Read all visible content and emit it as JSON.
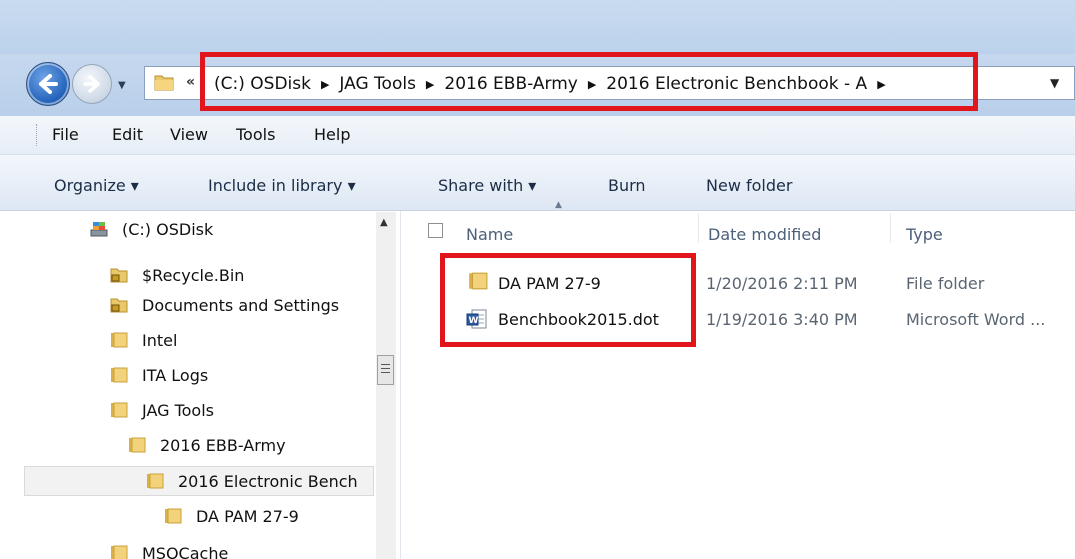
{
  "address_bar": {
    "overflow_glyph": "«",
    "crumbs": [
      "(C:) OSDisk",
      "JAG Tools",
      "2016 EBB-Army",
      "2016 Electronic Benchbook - A"
    ]
  },
  "menu": [
    "File",
    "Edit",
    "View",
    "Tools",
    "Help"
  ],
  "commands": {
    "organize": "Organize ▾",
    "include": "Include in library ▾",
    "share": "Share with ▾",
    "burn": "Burn",
    "new_folder": "New folder"
  },
  "tree": [
    {
      "label": "(C:) OSDisk",
      "icon": "drive-icon"
    },
    {
      "label": "$Recycle.Bin",
      "icon": "locked-folder-icon"
    },
    {
      "label": "Documents and Settings",
      "icon": "locked-folder-icon"
    },
    {
      "label": "Intel",
      "icon": "folder-icon"
    },
    {
      "label": "ITA Logs",
      "icon": "folder-icon"
    },
    {
      "label": "JAG Tools",
      "icon": "folder-icon"
    },
    {
      "label": "2016 EBB-Army",
      "icon": "folder-icon"
    },
    {
      "label": "2016 Electronic Bench",
      "icon": "folder-icon",
      "selected": true
    },
    {
      "label": "DA PAM 27-9",
      "icon": "folder-icon"
    },
    {
      "label": "MSOCache",
      "icon": "folder-icon"
    }
  ],
  "columns": {
    "name": "Name",
    "date": "Date modified",
    "type": "Type"
  },
  "files": [
    {
      "name": "DA PAM 27-9",
      "date": "1/20/2016 2:11 PM",
      "type": "File folder",
      "icon": "folder-icon"
    },
    {
      "name": "Benchbook2015.dot",
      "date": "1/19/2016 3:40 PM",
      "type": "Microsoft Word ...",
      "icon": "word-doc-icon"
    }
  ],
  "colors": {
    "highlight": "#e0161c",
    "folder": "#e9c86a"
  }
}
